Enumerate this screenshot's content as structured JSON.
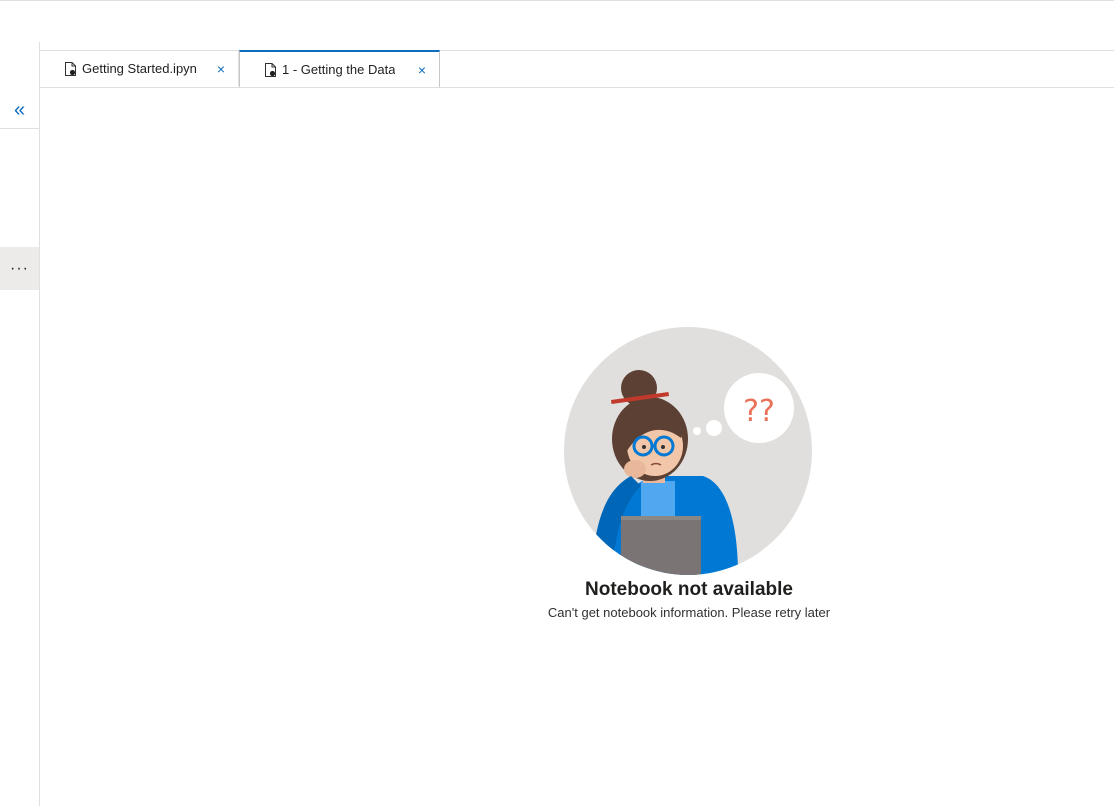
{
  "tabs": [
    {
      "label": "Getting Started.ipyn",
      "active": false
    },
    {
      "label": "1 - Getting the Data",
      "active": true
    }
  ],
  "tab_close_glyph": "×",
  "rail": {
    "collapse_glyph": "«",
    "more_glyph": "···"
  },
  "empty_state": {
    "question_marks": "??",
    "title": "Notebook not available",
    "message": "Can't get notebook information. Please retry later"
  },
  "colors": {
    "accent": "#0f6cbd",
    "circle": "#e1dfdd",
    "jacket": "#0078d4",
    "question_marks": "#e8735a"
  }
}
